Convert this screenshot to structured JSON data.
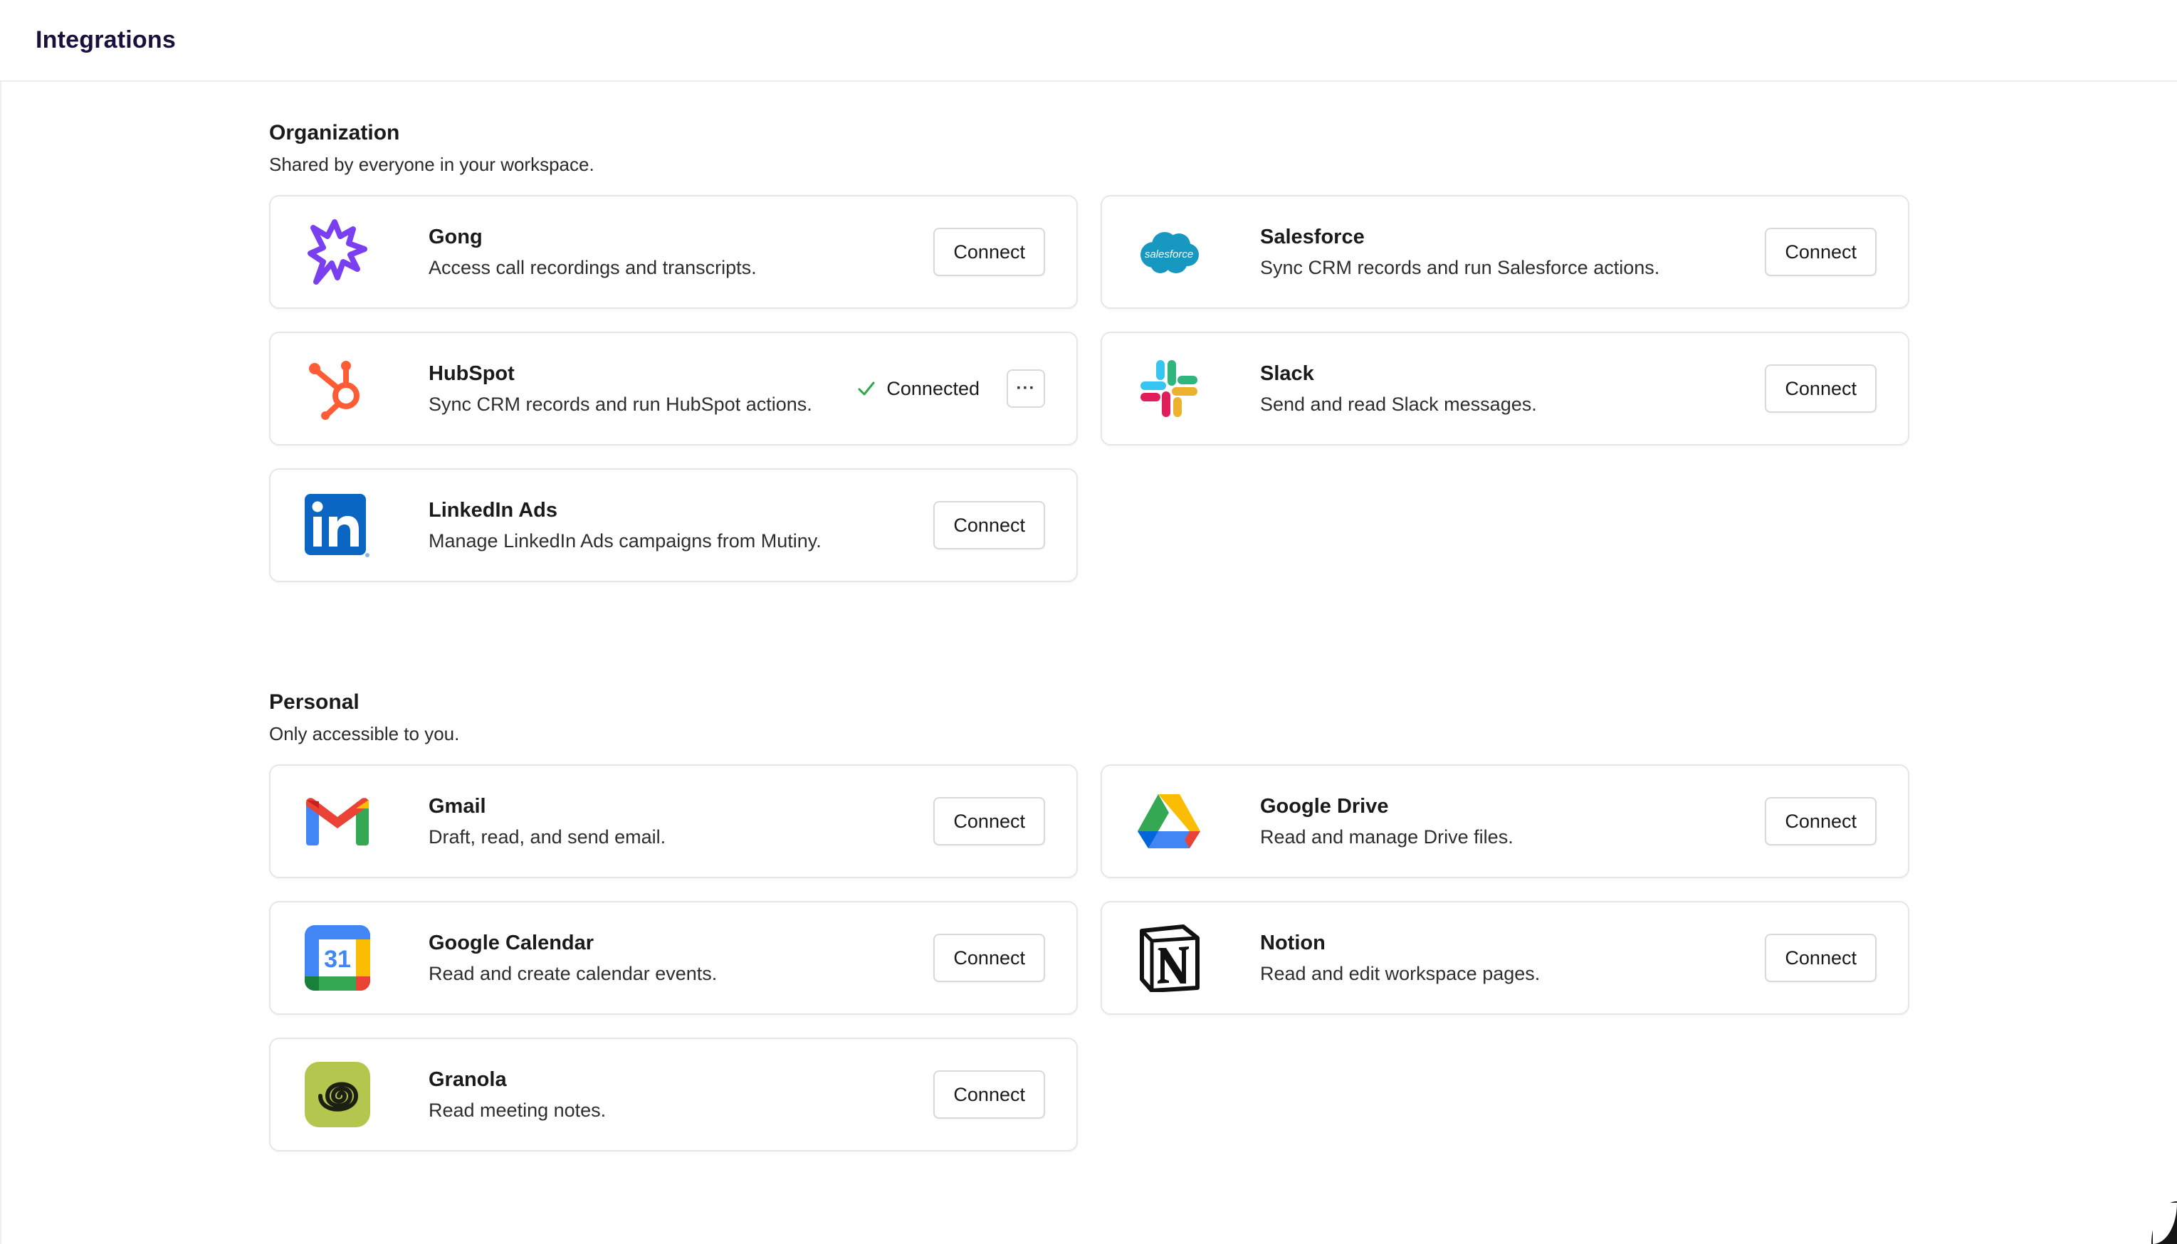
{
  "header": {
    "title": "Integrations"
  },
  "organization": {
    "title": "Organization",
    "subtitle": "Shared by everyone in your workspace.",
    "items": [
      {
        "name": "Gong",
        "description": "Access call recordings and transcripts.",
        "action": "Connect",
        "icon": "gong-icon"
      },
      {
        "name": "Salesforce",
        "description": "Sync CRM records and run Salesforce actions.",
        "action": "Connect",
        "icon": "salesforce-icon",
        "logo_text": "salesforce"
      },
      {
        "name": "HubSpot",
        "description": "Sync CRM records and run HubSpot actions.",
        "status": "Connected",
        "more": "···",
        "icon": "hubspot-icon"
      },
      {
        "name": "Slack",
        "description": "Send and read Slack messages.",
        "action": "Connect",
        "icon": "slack-icon"
      },
      {
        "name": "LinkedIn Ads",
        "description": "Manage LinkedIn Ads campaigns from Mutiny.",
        "action": "Connect",
        "icon": "linkedin-icon"
      }
    ]
  },
  "personal": {
    "title": "Personal",
    "subtitle": "Only accessible to you.",
    "items": [
      {
        "name": "Gmail",
        "description": "Draft, read, and send email.",
        "action": "Connect",
        "icon": "gmail-icon"
      },
      {
        "name": "Google Drive",
        "description": "Read and manage Drive files.",
        "action": "Connect",
        "icon": "google-drive-icon"
      },
      {
        "name": "Google Calendar",
        "description": "Read and create calendar events.",
        "action": "Connect",
        "icon": "google-calendar-icon",
        "logo_text": "31"
      },
      {
        "name": "Notion",
        "description": "Read and edit workspace pages.",
        "action": "Connect",
        "icon": "notion-icon"
      },
      {
        "name": "Granola",
        "description": "Read meeting notes.",
        "action": "Connect",
        "icon": "granola-icon"
      }
    ]
  },
  "colors": {
    "title": "#1c0f3b",
    "connected_check": "#2fa84f",
    "card_border": "#e6e6e6"
  }
}
